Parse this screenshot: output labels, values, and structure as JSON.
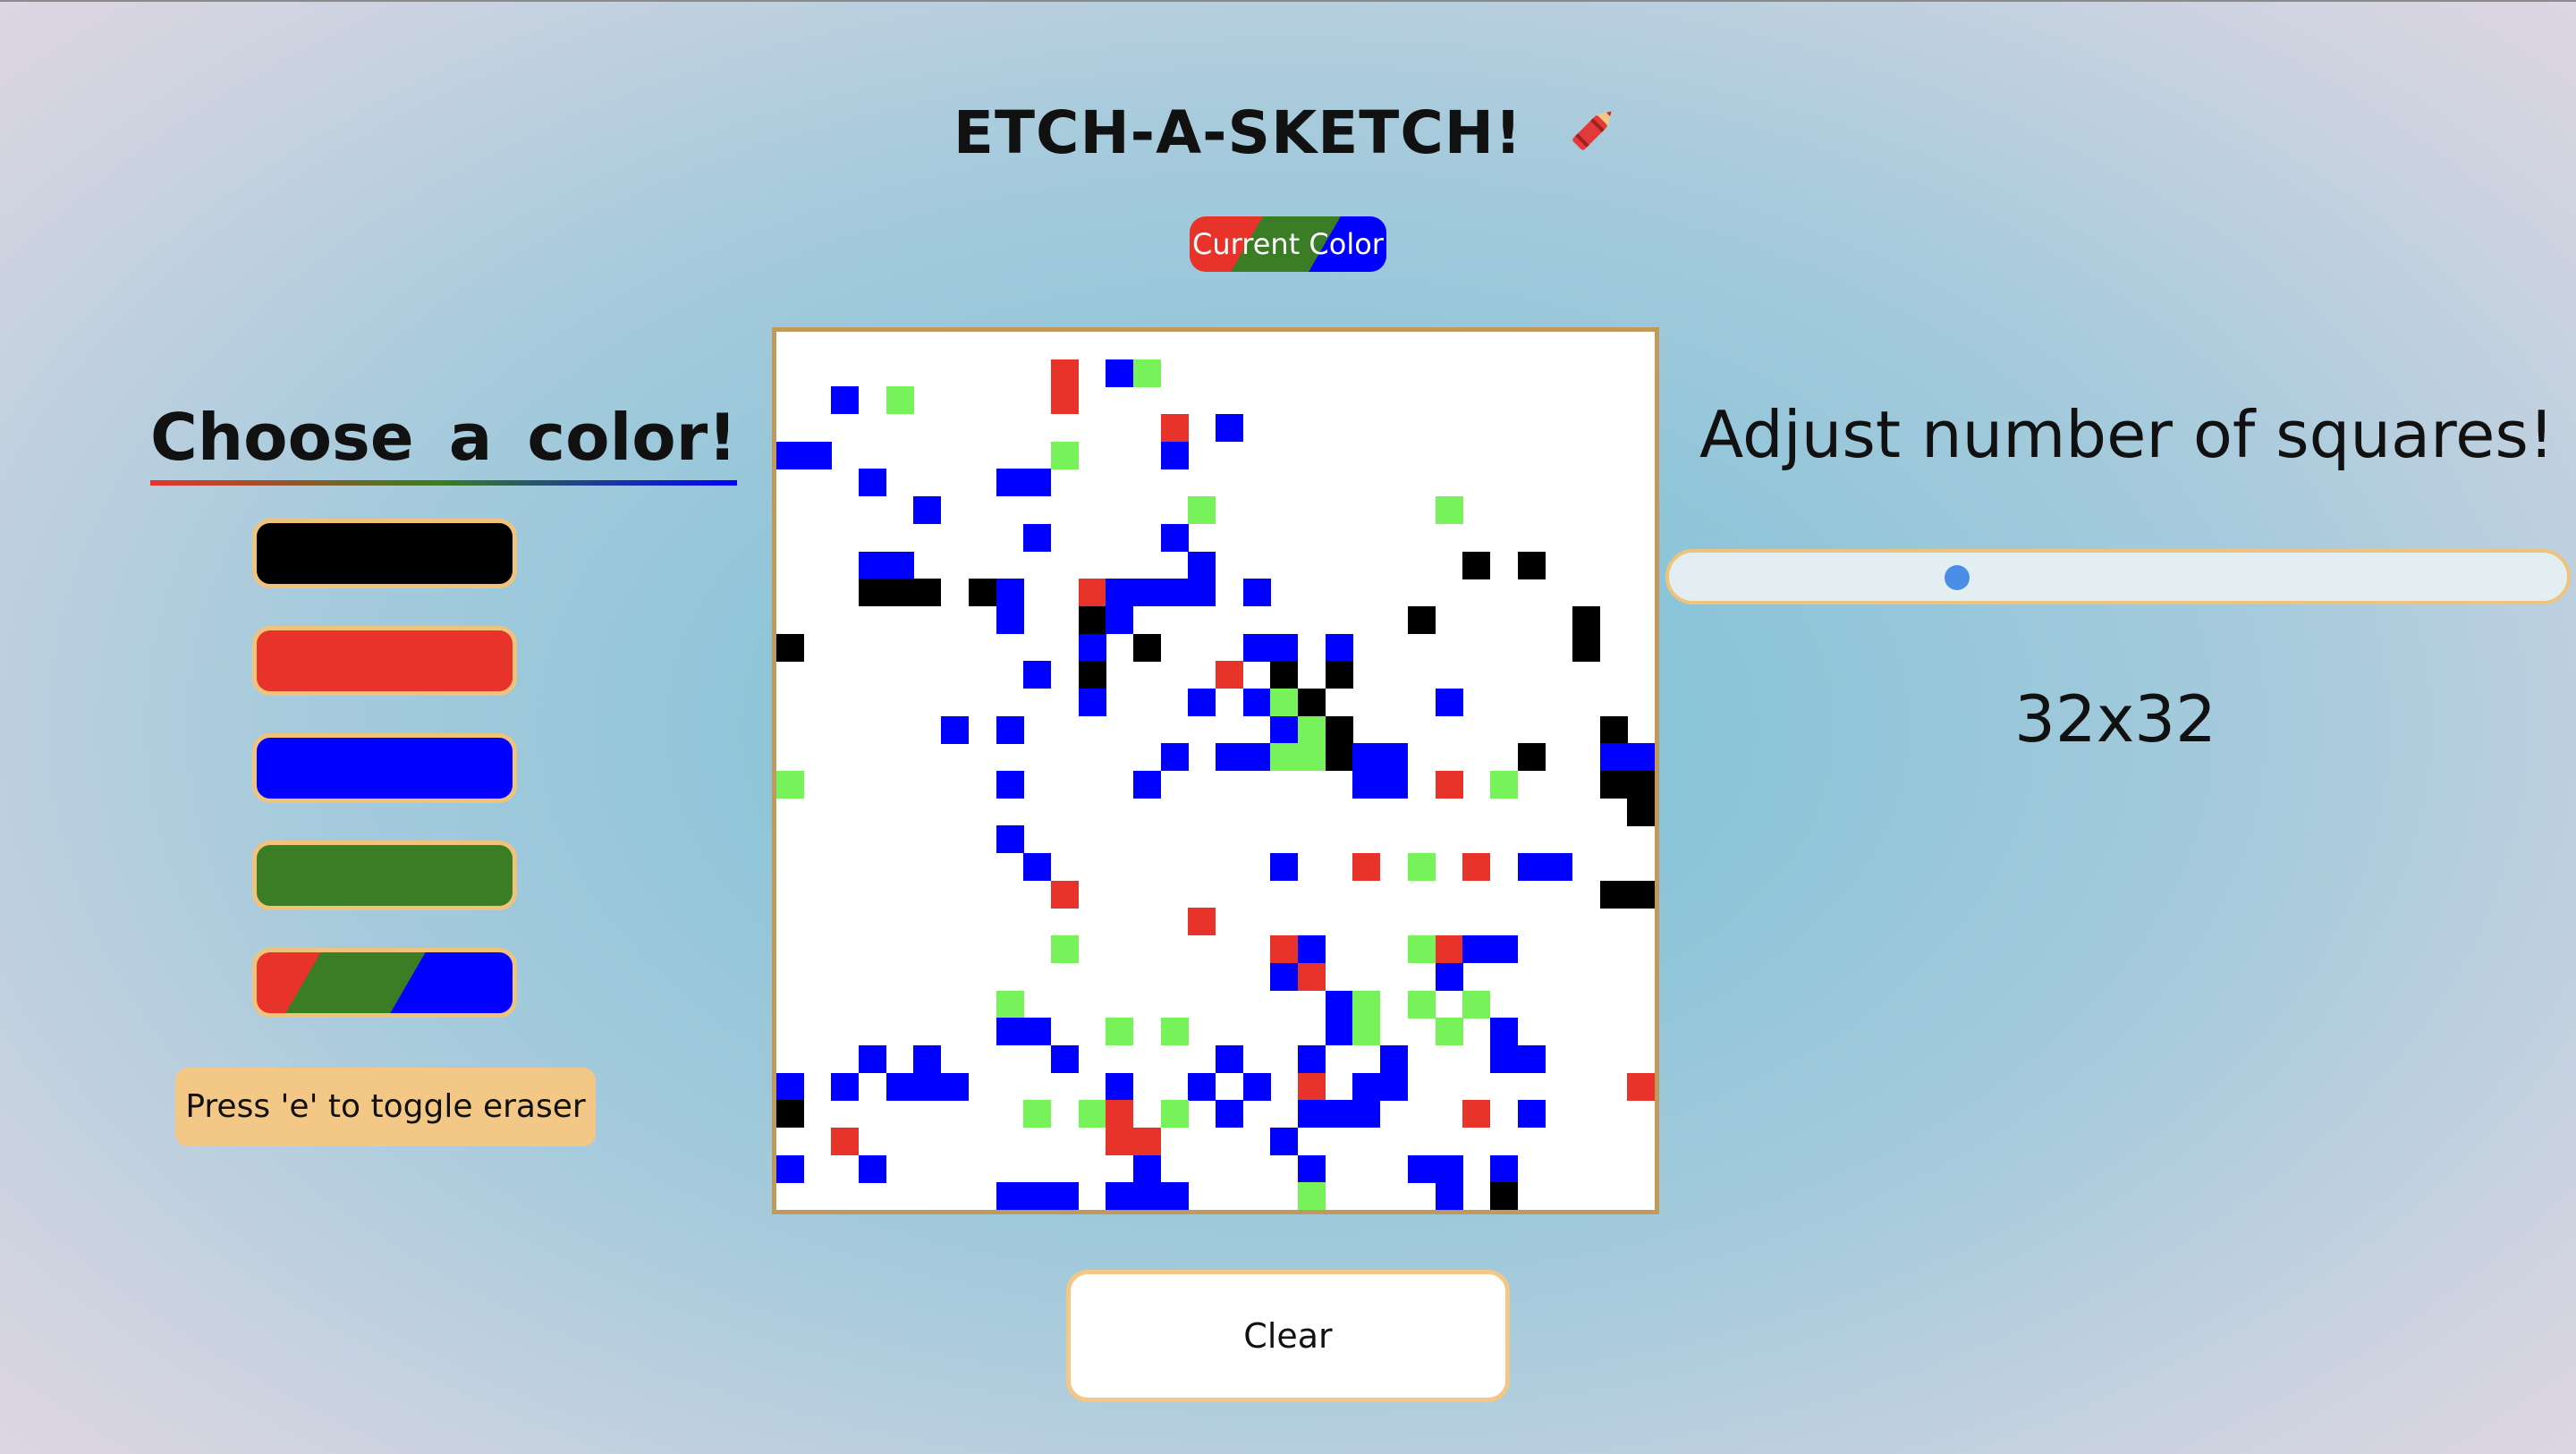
{
  "header": {
    "title": "ETCH-A-SKETCH!",
    "current_color_label": "Current Color"
  },
  "palette": {
    "heading": "Choose a color!",
    "swatches": [
      {
        "name": "black",
        "color": "#000000"
      },
      {
        "name": "red",
        "color": "#e8332a"
      },
      {
        "name": "blue",
        "color": "#0000ff"
      },
      {
        "name": "green",
        "color": "#3a7d24"
      },
      {
        "name": "rainbow",
        "colors": [
          "#e8332a",
          "#3a7d24",
          "#0000ff"
        ]
      }
    ],
    "eraser_hint": "Press 'e' to toggle eraser"
  },
  "canvas": {
    "grid_size": 32,
    "legend": {
      "K": "#000000",
      "R": "#e8332a",
      "B": "#0000ff",
      "G": "#77f25b"
    },
    "rows": [
      "................................",
      "..........R.BG..................",
      "..B.G.....R.....................",
      "..............R.B...............",
      "BB........G...B.................",
      "...B....BB......................",
      ".....B.........G........G.......",
      ".........B....B.................",
      "...BB..........B.........K.K....",
      "...KKK.KB..RBBBB.B..............",
      "........B..KB..........K.....K..",
      "K..........B.K...BB.B........K..",
      ".........B.K....R.K.K...........",
      "...........B...B.BGK....B.......",
      "......B.B.........BGK.........K.",
      "..............B.BBGGKBB....K..BB",
      "G.......B....B.......BB.R.G...KK",
      "...............................K",
      "........B.......................",
      ".........B........B..R.G.R.BB...",
      "..........R...................KK",
      "...............R................",
      "..........G.......RB...GRBB.....",
      "..................BR....B.......",
      "........G...........BG.G.G......",
      "........BB..G.G.....BG..G.B.....",
      "...B.B....B.....B..B..B...BB....",
      "B.B.BBB.....B..B.B.R.BB........R",
      "K........G.GR.G.B..BBB...R.B....",
      "..R.........RR....B.............",
      "B..B.........B.....B...BB.B.....",
      "........BBB.BBB....G....B.K....."
    ]
  },
  "controls": {
    "clear_label": "Clear",
    "size_heading": "Adjust number of squares!",
    "slider": {
      "min": 1,
      "max": 100,
      "value": 32
    },
    "size_display": "32x32"
  }
}
